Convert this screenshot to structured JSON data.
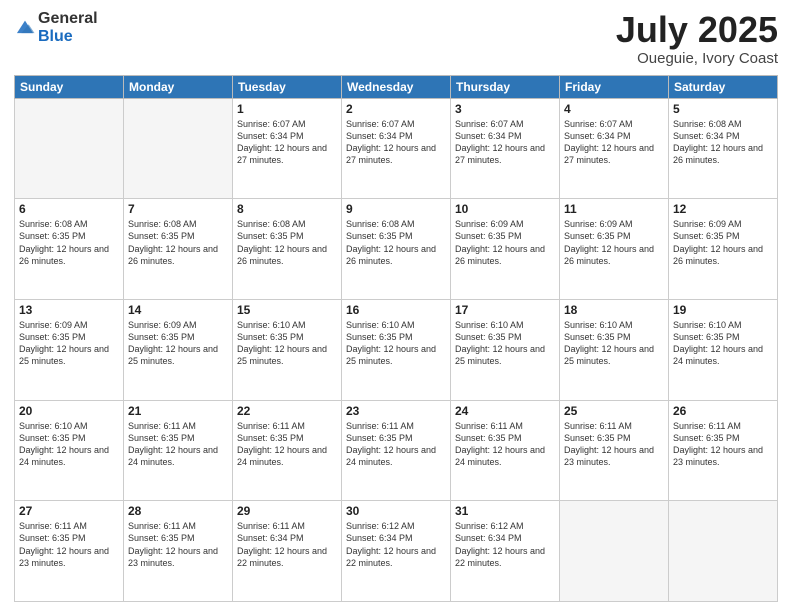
{
  "logo": {
    "general": "General",
    "blue": "Blue"
  },
  "title": {
    "month": "July 2025",
    "location": "Oueguie, Ivory Coast"
  },
  "weekdays": [
    "Sunday",
    "Monday",
    "Tuesday",
    "Wednesday",
    "Thursday",
    "Friday",
    "Saturday"
  ],
  "weeks": [
    [
      {
        "day": "",
        "info": ""
      },
      {
        "day": "",
        "info": ""
      },
      {
        "day": "1",
        "info": "Sunrise: 6:07 AM\nSunset: 6:34 PM\nDaylight: 12 hours and 27 minutes."
      },
      {
        "day": "2",
        "info": "Sunrise: 6:07 AM\nSunset: 6:34 PM\nDaylight: 12 hours and 27 minutes."
      },
      {
        "day": "3",
        "info": "Sunrise: 6:07 AM\nSunset: 6:34 PM\nDaylight: 12 hours and 27 minutes."
      },
      {
        "day": "4",
        "info": "Sunrise: 6:07 AM\nSunset: 6:34 PM\nDaylight: 12 hours and 27 minutes."
      },
      {
        "day": "5",
        "info": "Sunrise: 6:08 AM\nSunset: 6:34 PM\nDaylight: 12 hours and 26 minutes."
      }
    ],
    [
      {
        "day": "6",
        "info": "Sunrise: 6:08 AM\nSunset: 6:35 PM\nDaylight: 12 hours and 26 minutes."
      },
      {
        "day": "7",
        "info": "Sunrise: 6:08 AM\nSunset: 6:35 PM\nDaylight: 12 hours and 26 minutes."
      },
      {
        "day": "8",
        "info": "Sunrise: 6:08 AM\nSunset: 6:35 PM\nDaylight: 12 hours and 26 minutes."
      },
      {
        "day": "9",
        "info": "Sunrise: 6:08 AM\nSunset: 6:35 PM\nDaylight: 12 hours and 26 minutes."
      },
      {
        "day": "10",
        "info": "Sunrise: 6:09 AM\nSunset: 6:35 PM\nDaylight: 12 hours and 26 minutes."
      },
      {
        "day": "11",
        "info": "Sunrise: 6:09 AM\nSunset: 6:35 PM\nDaylight: 12 hours and 26 minutes."
      },
      {
        "day": "12",
        "info": "Sunrise: 6:09 AM\nSunset: 6:35 PM\nDaylight: 12 hours and 26 minutes."
      }
    ],
    [
      {
        "day": "13",
        "info": "Sunrise: 6:09 AM\nSunset: 6:35 PM\nDaylight: 12 hours and 25 minutes."
      },
      {
        "day": "14",
        "info": "Sunrise: 6:09 AM\nSunset: 6:35 PM\nDaylight: 12 hours and 25 minutes."
      },
      {
        "day": "15",
        "info": "Sunrise: 6:10 AM\nSunset: 6:35 PM\nDaylight: 12 hours and 25 minutes."
      },
      {
        "day": "16",
        "info": "Sunrise: 6:10 AM\nSunset: 6:35 PM\nDaylight: 12 hours and 25 minutes."
      },
      {
        "day": "17",
        "info": "Sunrise: 6:10 AM\nSunset: 6:35 PM\nDaylight: 12 hours and 25 minutes."
      },
      {
        "day": "18",
        "info": "Sunrise: 6:10 AM\nSunset: 6:35 PM\nDaylight: 12 hours and 25 minutes."
      },
      {
        "day": "19",
        "info": "Sunrise: 6:10 AM\nSunset: 6:35 PM\nDaylight: 12 hours and 24 minutes."
      }
    ],
    [
      {
        "day": "20",
        "info": "Sunrise: 6:10 AM\nSunset: 6:35 PM\nDaylight: 12 hours and 24 minutes."
      },
      {
        "day": "21",
        "info": "Sunrise: 6:11 AM\nSunset: 6:35 PM\nDaylight: 12 hours and 24 minutes."
      },
      {
        "day": "22",
        "info": "Sunrise: 6:11 AM\nSunset: 6:35 PM\nDaylight: 12 hours and 24 minutes."
      },
      {
        "day": "23",
        "info": "Sunrise: 6:11 AM\nSunset: 6:35 PM\nDaylight: 12 hours and 24 minutes."
      },
      {
        "day": "24",
        "info": "Sunrise: 6:11 AM\nSunset: 6:35 PM\nDaylight: 12 hours and 24 minutes."
      },
      {
        "day": "25",
        "info": "Sunrise: 6:11 AM\nSunset: 6:35 PM\nDaylight: 12 hours and 23 minutes."
      },
      {
        "day": "26",
        "info": "Sunrise: 6:11 AM\nSunset: 6:35 PM\nDaylight: 12 hours and 23 minutes."
      }
    ],
    [
      {
        "day": "27",
        "info": "Sunrise: 6:11 AM\nSunset: 6:35 PM\nDaylight: 12 hours and 23 minutes."
      },
      {
        "day": "28",
        "info": "Sunrise: 6:11 AM\nSunset: 6:35 PM\nDaylight: 12 hours and 23 minutes."
      },
      {
        "day": "29",
        "info": "Sunrise: 6:11 AM\nSunset: 6:34 PM\nDaylight: 12 hours and 22 minutes."
      },
      {
        "day": "30",
        "info": "Sunrise: 6:12 AM\nSunset: 6:34 PM\nDaylight: 12 hours and 22 minutes."
      },
      {
        "day": "31",
        "info": "Sunrise: 6:12 AM\nSunset: 6:34 PM\nDaylight: 12 hours and 22 minutes."
      },
      {
        "day": "",
        "info": ""
      },
      {
        "day": "",
        "info": ""
      }
    ]
  ]
}
